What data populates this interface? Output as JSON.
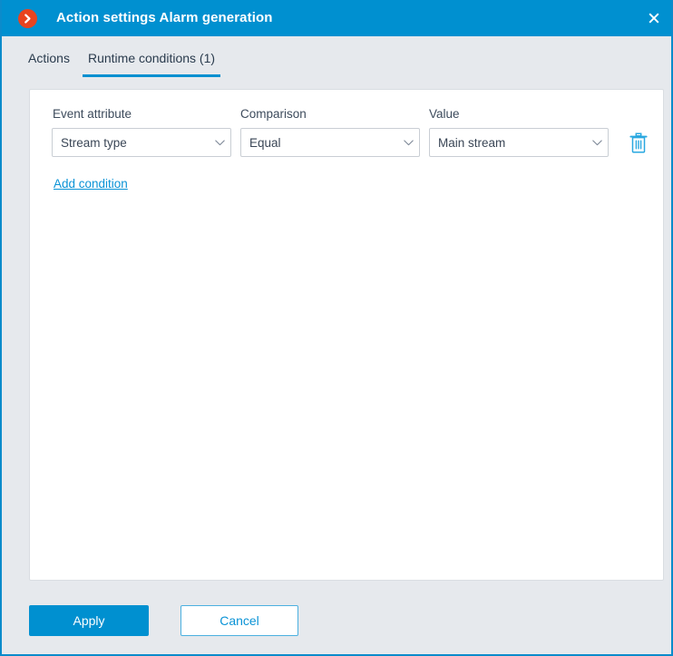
{
  "window": {
    "title": "Action settings Alarm generation",
    "app_icon": "chevron-right-circle-icon",
    "close_icon": "close-icon",
    "accent_blue": "#0090d0",
    "badge_orange": "#e8441f",
    "link_blue": "#0a93d6",
    "panel_background": "#ffffff",
    "window_background": "#e6e9ed"
  },
  "tabs": [
    {
      "label": "Actions",
      "active": false
    },
    {
      "label": "Runtime conditions (1)",
      "active": true
    }
  ],
  "conditions_form": {
    "labels": {
      "event_attribute": "Event attribute",
      "comparison": "Comparison",
      "value": "Value"
    },
    "rows": [
      {
        "event_attribute": {
          "selected": "Stream type",
          "options": [
            "Stream type"
          ],
          "chevron": "chevron-down-icon"
        },
        "comparison": {
          "selected": "Equal",
          "options": [
            "Equal"
          ],
          "chevron": "chevron-down-icon"
        },
        "value": {
          "selected": "Main stream",
          "options": [
            "Main stream"
          ],
          "chevron": "chevron-down-icon"
        },
        "delete_icon": "trash-icon"
      }
    ],
    "add_condition_link": "Add condition"
  },
  "footer": {
    "apply_label": "Apply",
    "cancel_label": "Cancel"
  }
}
